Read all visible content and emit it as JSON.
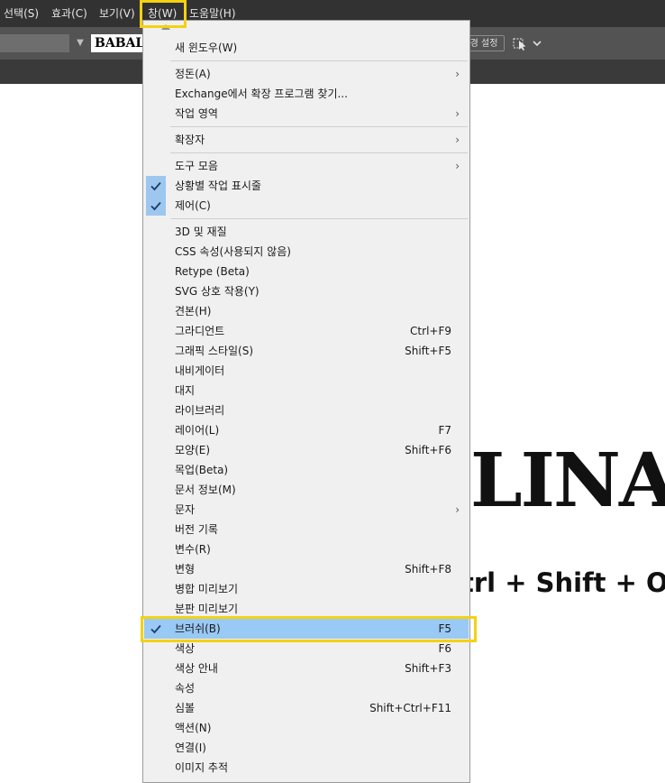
{
  "menubar": {
    "items": [
      {
        "label": "선택(S)"
      },
      {
        "label": "효과(C)"
      },
      {
        "label": "보기(V)"
      },
      {
        "label": "창(W)"
      },
      {
        "label": "도움말(H)"
      }
    ]
  },
  "control_bar": {
    "font_preview": "BABALI",
    "settings_button": "경 설정"
  },
  "canvas": {
    "large_text": "LINA",
    "shortcut_text": "trl + Shift + O"
  },
  "window_menu": {
    "items": [
      {
        "label": "새 윈도우(W)",
        "shortcut": "",
        "checked": false,
        "submenu": false
      },
      {
        "label": "정돈(A)",
        "shortcut": "",
        "checked": false,
        "submenu": true
      },
      {
        "label": "Exchange에서 확장 프로그램 찾기...",
        "shortcut": "",
        "checked": false,
        "submenu": false
      },
      {
        "label": "작업 영역",
        "shortcut": "",
        "checked": false,
        "submenu": true
      },
      {
        "label": "확장자",
        "shortcut": "",
        "checked": false,
        "submenu": true
      },
      {
        "label": "도구 모음",
        "shortcut": "",
        "checked": false,
        "submenu": true
      },
      {
        "label": "상황별 작업 표시줄",
        "shortcut": "",
        "checked": true,
        "submenu": false
      },
      {
        "label": "제어(C)",
        "shortcut": "",
        "checked": true,
        "submenu": false
      },
      {
        "label": "3D 및 재질",
        "shortcut": "",
        "checked": false,
        "submenu": false
      },
      {
        "label": "CSS 속성(사용되지 않음)",
        "shortcut": "",
        "checked": false,
        "submenu": false
      },
      {
        "label": "Retype (Beta)",
        "shortcut": "",
        "checked": false,
        "submenu": false
      },
      {
        "label": "SVG 상호 작용(Y)",
        "shortcut": "",
        "checked": false,
        "submenu": false
      },
      {
        "label": "견본(H)",
        "shortcut": "",
        "checked": false,
        "submenu": false
      },
      {
        "label": "그라디언트",
        "shortcut": "Ctrl+F9",
        "checked": false,
        "submenu": false
      },
      {
        "label": "그래픽 스타일(S)",
        "shortcut": "Shift+F5",
        "checked": false,
        "submenu": false
      },
      {
        "label": "내비게이터",
        "shortcut": "",
        "checked": false,
        "submenu": false
      },
      {
        "label": "대지",
        "shortcut": "",
        "checked": false,
        "submenu": false
      },
      {
        "label": "라이브러리",
        "shortcut": "",
        "checked": false,
        "submenu": false
      },
      {
        "label": "레이어(L)",
        "shortcut": "F7",
        "checked": false,
        "submenu": false
      },
      {
        "label": "모양(E)",
        "shortcut": "Shift+F6",
        "checked": false,
        "submenu": false
      },
      {
        "label": "목업(Beta)",
        "shortcut": "",
        "checked": false,
        "submenu": false
      },
      {
        "label": "문서 정보(M)",
        "shortcut": "",
        "checked": false,
        "submenu": false
      },
      {
        "label": "문자",
        "shortcut": "",
        "checked": false,
        "submenu": true
      },
      {
        "label": "버전 기록",
        "shortcut": "",
        "checked": false,
        "submenu": false
      },
      {
        "label": "변수(R)",
        "shortcut": "",
        "checked": false,
        "submenu": false
      },
      {
        "label": "변형",
        "shortcut": "Shift+F8",
        "checked": false,
        "submenu": false
      },
      {
        "label": "병합 미리보기",
        "shortcut": "",
        "checked": false,
        "submenu": false
      },
      {
        "label": "분판 미리보기",
        "shortcut": "",
        "checked": false,
        "submenu": false
      },
      {
        "label": "브러쉬(B)",
        "shortcut": "F5",
        "checked": true,
        "submenu": false,
        "selected": true
      },
      {
        "label": "색상",
        "shortcut": "F6",
        "checked": false,
        "submenu": false
      },
      {
        "label": "색상 안내",
        "shortcut": "Shift+F3",
        "checked": false,
        "submenu": false
      },
      {
        "label": "속성",
        "shortcut": "",
        "checked": false,
        "submenu": false
      },
      {
        "label": "심볼",
        "shortcut": "Shift+Ctrl+F11",
        "checked": false,
        "submenu": false
      },
      {
        "label": "액션(N)",
        "shortcut": "",
        "checked": false,
        "submenu": false
      },
      {
        "label": "연결(I)",
        "shortcut": "",
        "checked": false,
        "submenu": false
      },
      {
        "label": "이미지 추적",
        "shortcut": "",
        "checked": false,
        "submenu": false
      }
    ]
  },
  "colors": {
    "menubar_bg": "#323232",
    "menu_bg": "#f0f0f0",
    "selected_bg": "#99c9f5",
    "highlight_outline": "#f5d112",
    "check_bg": "#9dc7ef"
  }
}
